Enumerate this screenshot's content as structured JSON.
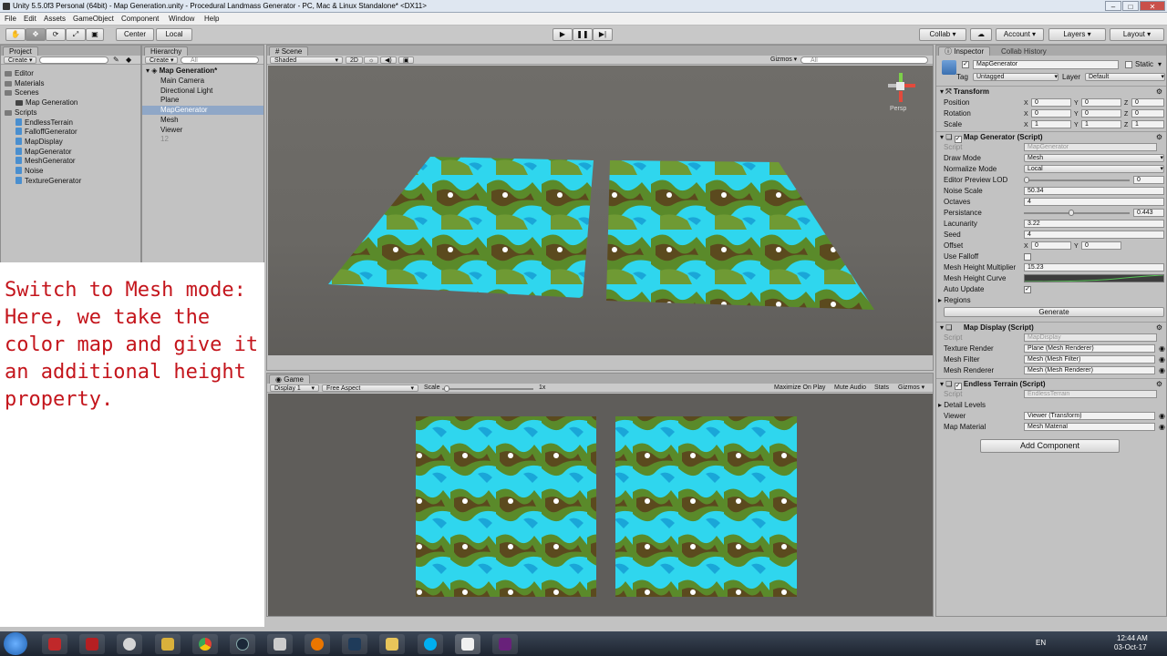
{
  "window": {
    "title": "Unity 5.5.0f3 Personal (64bit) - Map Generation.unity - Procedural Landmass Generator - PC, Mac & Linux Standalone* <DX11>"
  },
  "menu": [
    "File",
    "Edit",
    "Assets",
    "GameObject",
    "Component",
    "Window",
    "Help"
  ],
  "toolbar": {
    "pivot": "Center",
    "space": "Local",
    "collab": "Collab",
    "account": "Account",
    "layers": "Layers",
    "layout": "Layout"
  },
  "project": {
    "tab": "Project",
    "create": "Create",
    "search_placeholder": "",
    "items": [
      {
        "label": "Editor",
        "kind": "folder",
        "indent": 0
      },
      {
        "label": "Materials",
        "kind": "folder",
        "indent": 0
      },
      {
        "label": "Scenes",
        "kind": "folder",
        "indent": 0
      },
      {
        "label": "Map Generation",
        "kind": "scene",
        "indent": 1
      },
      {
        "label": "Scripts",
        "kind": "folder",
        "indent": 0
      },
      {
        "label": "EndlessTerrain",
        "kind": "script",
        "indent": 1
      },
      {
        "label": "FalloffGenerator",
        "kind": "script",
        "indent": 1
      },
      {
        "label": "MapDisplay",
        "kind": "script",
        "indent": 1
      },
      {
        "label": "MapGenerator",
        "kind": "script",
        "indent": 1
      },
      {
        "label": "MeshGenerator",
        "kind": "script",
        "indent": 1
      },
      {
        "label": "Noise",
        "kind": "script",
        "indent": 1
      },
      {
        "label": "TextureGenerator",
        "kind": "script",
        "indent": 1
      }
    ]
  },
  "hierarchy": {
    "tab": "Hierarchy",
    "create": "Create",
    "search_placeholder": "All",
    "scene": "Map Generation*",
    "items": [
      {
        "label": "Main Camera",
        "selected": false,
        "dim": false
      },
      {
        "label": "Directional Light",
        "selected": false,
        "dim": false
      },
      {
        "label": "Plane",
        "selected": false,
        "dim": false
      },
      {
        "label": "MapGenerator",
        "selected": true,
        "dim": false
      },
      {
        "label": "Mesh",
        "selected": false,
        "dim": false
      },
      {
        "label": "Viewer",
        "selected": false,
        "dim": false
      },
      {
        "label": "12",
        "selected": false,
        "dim": true
      }
    ]
  },
  "scene": {
    "tab": "Scene",
    "shading": "Shaded",
    "mode_2d": "2D",
    "gizmos": "Gizmos",
    "search_placeholder": "All",
    "persp": "Persp"
  },
  "game": {
    "tab": "Game",
    "display": "Display 1",
    "aspect": "Free Aspect",
    "scale_label": "Scale",
    "scale_value": "1x",
    "maximize": "Maximize On Play",
    "mute": "Mute Audio",
    "stats": "Stats",
    "gizmos": "Gizmos"
  },
  "annotation": {
    "text": "Switch to Mesh mode:\nHere, we take the\ncolor map and give it\nan additional height\nproperty."
  },
  "inspector": {
    "tab": "Inspector",
    "tab2": "Collab History",
    "object_name": "MapGenerator",
    "static_label": "Static",
    "tag_label": "Tag",
    "tag_value": "Untagged",
    "layer_label": "Layer",
    "layer_value": "Default",
    "transform": {
      "title": "Transform",
      "position": {
        "label": "Position",
        "x": "0",
        "y": "0",
        "z": "0"
      },
      "rotation": {
        "label": "Rotation",
        "x": "0",
        "y": "0",
        "z": "0"
      },
      "scale": {
        "label": "Scale",
        "x": "1",
        "y": "1",
        "z": "1"
      }
    },
    "map_generator": {
      "title": "Map Generator (Script)",
      "script_label": "Script",
      "script_value": "MapGenerator",
      "draw_mode_label": "Draw Mode",
      "draw_mode": "Mesh",
      "normalize_label": "Normalize Mode",
      "normalize": "Local",
      "lod_label": "Editor Preview LOD",
      "lod": "0",
      "lod_fraction": 0,
      "noise_scale_label": "Noise Scale",
      "noise_scale": "50.34",
      "octaves_label": "Octaves",
      "octaves": "4",
      "persistance_label": "Persistance",
      "persistance": "0.443",
      "persistance_fraction": 0.443,
      "lacunarity_label": "Lacunarity",
      "lacunarity": "3.22",
      "seed_label": "Seed",
      "seed": "4",
      "offset_label": "Offset",
      "offset_x": "0",
      "offset_y": "0",
      "use_falloff_label": "Use Falloff",
      "use_falloff": false,
      "mesh_height_mult_label": "Mesh Height Multiplier",
      "mesh_height_mult": "15.23",
      "mesh_height_curve_label": "Mesh Height Curve",
      "auto_update_label": "Auto Update",
      "auto_update": true,
      "regions_label": "Regions",
      "generate": "Generate"
    },
    "map_display": {
      "title": "Map Display (Script)",
      "script_label": "Script",
      "script_value": "MapDisplay",
      "texture_render_label": "Texture Render",
      "texture_render": "Plane (Mesh Renderer)",
      "mesh_filter_label": "Mesh Filter",
      "mesh_filter": "Mesh (Mesh Filter)",
      "mesh_renderer_label": "Mesh Renderer",
      "mesh_renderer": "Mesh (Mesh Renderer)"
    },
    "endless_terrain": {
      "title": "Endless Terrain (Script)",
      "script_label": "Script",
      "script_value": "EndlessTerrain",
      "detail_levels_label": "Detail Levels",
      "viewer_label": "Viewer",
      "viewer": "Viewer (Transform)",
      "map_material_label": "Map Material",
      "map_material": "Mesh Material"
    },
    "add_component": "Add Component"
  },
  "taskbar": {
    "lang": "EN",
    "time": "12:44 AM",
    "date": "03-Oct-17"
  },
  "colors": {
    "water": "#2fd6ee",
    "deep_water": "#1aa6d8",
    "grass": "#5a8a2a",
    "mountain": "#5b4a1e",
    "snow": "#ffffff",
    "annotation_text": "#c4151c"
  }
}
